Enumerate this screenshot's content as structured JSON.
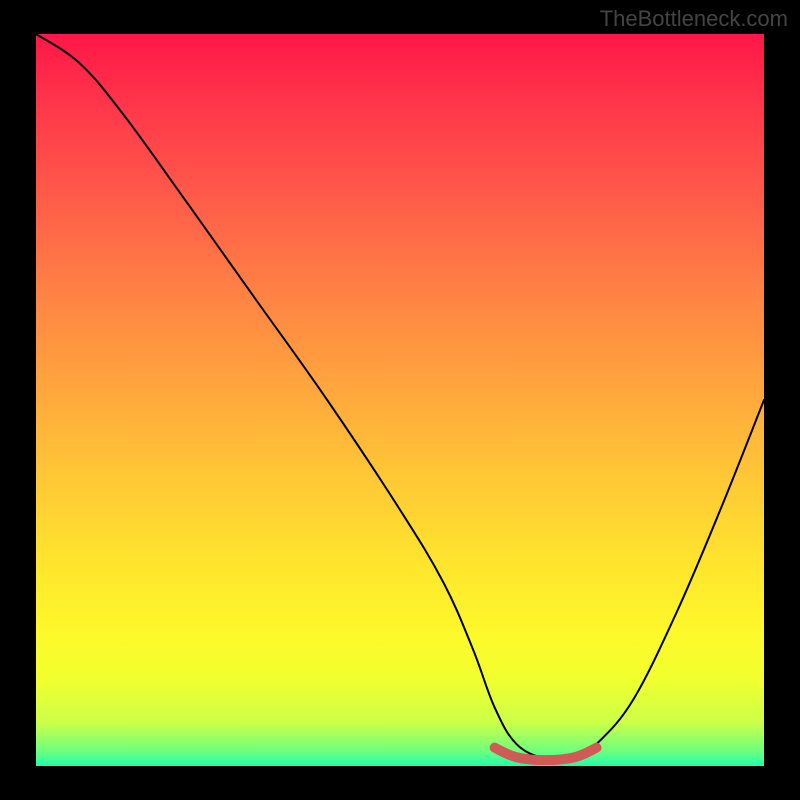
{
  "watermark": "TheBottleneck.com",
  "chart_data": {
    "type": "line",
    "title": "",
    "xlabel": "",
    "ylabel": "",
    "xlim": [
      0,
      100
    ],
    "ylim": [
      0,
      100
    ],
    "note": "Axes unlabeled in source; values are normalized 0–100. Curve represents bottleneck percentage vs. component balance; minimum (optimal, green) plateau occurs roughly at x=64–75. Background gradient encodes severity: top (red) = high bottleneck, bottom (green) = none. Short thick segment at the trough is an emphasis marker.",
    "series": [
      {
        "name": "bottleneck-curve",
        "x": [
          0,
          6,
          12,
          20,
          30,
          40,
          50,
          56,
          60,
          63,
          66,
          70,
          74,
          77,
          82,
          88,
          94,
          100
        ],
        "y": [
          100,
          96,
          89,
          78,
          64,
          50,
          35,
          25,
          16,
          8,
          3,
          1,
          1,
          3,
          9,
          21,
          35,
          50
        ]
      },
      {
        "name": "optimal-marker",
        "x": [
          63,
          66,
          70,
          74,
          77
        ],
        "y": [
          2.5,
          1.2,
          0.8,
          1.2,
          2.5
        ]
      }
    ],
    "gradient_stops": [
      {
        "pos": 0.0,
        "color": "#ff1748"
      },
      {
        "pos": 0.11,
        "color": "#ff3a4a"
      },
      {
        "pos": 0.24,
        "color": "#ff6049"
      },
      {
        "pos": 0.36,
        "color": "#ff8444"
      },
      {
        "pos": 0.48,
        "color": "#ffa53e"
      },
      {
        "pos": 0.6,
        "color": "#ffc636"
      },
      {
        "pos": 0.72,
        "color": "#ffe42e"
      },
      {
        "pos": 0.82,
        "color": "#fdf92a"
      },
      {
        "pos": 0.88,
        "color": "#f2ff2e"
      },
      {
        "pos": 0.94,
        "color": "#cdff48"
      },
      {
        "pos": 0.98,
        "color": "#6dff7e"
      },
      {
        "pos": 1.0,
        "color": "#20ffae"
      }
    ]
  }
}
